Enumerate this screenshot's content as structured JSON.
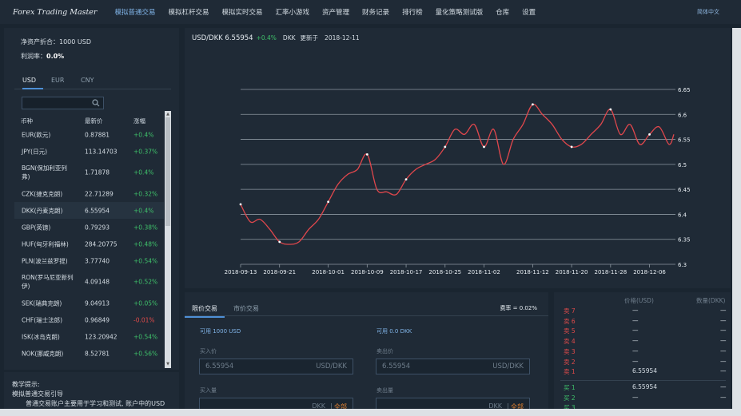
{
  "app": {
    "logo": "Forex Trading Master",
    "lang": "简体中文"
  },
  "nav": [
    "模拟普通交易",
    "模拟杠杆交易",
    "模拟实时交易",
    "汇率小游戏",
    "资产管理",
    "财务记录",
    "排行榜",
    "量化策略测试版",
    "仓库",
    "设置"
  ],
  "account": {
    "net_label": "净资产折合：",
    "net_value": "1000 USD",
    "profit_label": "利润率：",
    "profit_value": "0.0%"
  },
  "currency_tabs": [
    "USD",
    "EUR",
    "CNY"
  ],
  "search": {
    "placeholder": ""
  },
  "table": {
    "headers": [
      "币种",
      "最新价",
      "涨幅"
    ],
    "rows": [
      {
        "name": "EUR(欧元)",
        "price": "0.87881",
        "chg": "+0.4%",
        "dir": "up"
      },
      {
        "name": "JPY(日元)",
        "price": "113.14703",
        "chg": "+0.37%",
        "dir": "up"
      },
      {
        "name": "BGN(保加利亚列弗)",
        "price": "1.71878",
        "chg": "+0.4%",
        "dir": "up"
      },
      {
        "name": "CZK(捷克克朗)",
        "price": "22.71289",
        "chg": "+0.32%",
        "dir": "up"
      },
      {
        "name": "DKK(丹麦克朗)",
        "price": "6.55954",
        "chg": "+0.4%",
        "dir": "up"
      },
      {
        "name": "GBP(英镑)",
        "price": "0.79293",
        "chg": "+0.38%",
        "dir": "up"
      },
      {
        "name": "HUF(匈牙利福林)",
        "price": "284.20775",
        "chg": "+0.48%",
        "dir": "up"
      },
      {
        "name": "PLN(波兰兹罗提)",
        "price": "3.77740",
        "chg": "+0.54%",
        "dir": "up"
      },
      {
        "name": "RON(罗马尼亚新列伊)",
        "price": "4.09148",
        "chg": "+0.52%",
        "dir": "up"
      },
      {
        "name": "SEK(瑞典克朗)",
        "price": "9.04913",
        "chg": "+0.05%",
        "dir": "up"
      },
      {
        "name": "CHF(瑞士法郎)",
        "price": "0.96849",
        "chg": "-0.01%",
        "dir": "down"
      },
      {
        "name": "ISK(冰岛克朗)",
        "price": "123.20942",
        "chg": "+0.54%",
        "dir": "up"
      },
      {
        "name": "NOK(挪威克朗)",
        "price": "8.52781",
        "chg": "+0.56%",
        "dir": "up"
      }
    ]
  },
  "teach": {
    "title": "教学提示:",
    "line1": "模拟普通交易引导",
    "line2": "普通交易账户主要用于学习和测试, 账户中的USD"
  },
  "chart_header": {
    "pair": "USD/DKK 6.55954",
    "change": "+0.4%",
    "unit": "DKK",
    "updated": "更新于",
    "date": "2018-12-11"
  },
  "chart_data": {
    "type": "line",
    "x": [
      "2018-09-13",
      "2018-09-15",
      "2018-09-17",
      "2018-09-19",
      "2018-09-21",
      "2018-09-23",
      "2018-09-25",
      "2018-09-27",
      "2018-09-29",
      "2018-10-01",
      "2018-10-03",
      "2018-10-05",
      "2018-10-07",
      "2018-10-09",
      "2018-10-11",
      "2018-10-13",
      "2018-10-15",
      "2018-10-17",
      "2018-10-19",
      "2018-10-21",
      "2018-10-23",
      "2018-10-25",
      "2018-10-27",
      "2018-10-29",
      "2018-10-31",
      "2018-11-02",
      "2018-11-04",
      "2018-11-06",
      "2018-11-08",
      "2018-11-10",
      "2018-11-12",
      "2018-11-14",
      "2018-11-16",
      "2018-11-18",
      "2018-11-20",
      "2018-11-22",
      "2018-11-24",
      "2018-11-26",
      "2018-11-28",
      "2018-11-30",
      "2018-12-02",
      "2018-12-04",
      "2018-12-06",
      "2018-12-08",
      "2018-12-10",
      "2018-12-11"
    ],
    "values": [
      6.42,
      6.385,
      6.39,
      6.37,
      6.345,
      6.34,
      6.345,
      6.37,
      6.39,
      6.425,
      6.46,
      6.48,
      6.49,
      6.52,
      6.45,
      6.445,
      6.44,
      6.47,
      6.49,
      6.5,
      6.51,
      6.535,
      6.57,
      6.56,
      6.58,
      6.535,
      6.57,
      6.5,
      6.55,
      6.58,
      6.62,
      6.6,
      6.58,
      6.55,
      6.535,
      6.54,
      6.56,
      6.58,
      6.61,
      6.56,
      6.58,
      6.54,
      6.56,
      6.575,
      6.54,
      6.56
    ],
    "xticks": [
      "2018-09-13",
      "2018-09-21",
      "2018-10-01",
      "2018-10-09",
      "2018-10-17",
      "2018-10-25",
      "2018-11-02",
      "2018-11-12",
      "2018-11-20",
      "2018-11-28",
      "2018-12-06"
    ],
    "yticks": [
      "6.3",
      "6.35",
      "6.4",
      "6.45",
      "6.5",
      "6.55",
      "6.6",
      "6.65"
    ],
    "ylim": [
      6.3,
      6.65
    ],
    "grid": true,
    "line_color": "#e0474c"
  },
  "trade": {
    "tabs": [
      "限价交易",
      "市价交易"
    ],
    "fee": "费率 = 0.02%",
    "buy": {
      "avail": "可用 1000 USD",
      "price_label": "买入价",
      "price": "6.55954",
      "price_unit": "USD/DKK",
      "amount_label": "买入量",
      "amount_unit": "DKK",
      "all": "全部",
      "sep": "|"
    },
    "sell": {
      "avail": "可用 0.0 DKK",
      "price_label": "卖出价",
      "price": "6.55954",
      "price_unit": "USD/DKK",
      "amount_label": "卖出量",
      "amount_unit": "DKK",
      "all": "全部",
      "sep": "|"
    }
  },
  "orderbook": {
    "price_header": "价格(USD)",
    "qty_header": "数量(DKK)",
    "asks": [
      {
        "label": "卖 7",
        "price": "—",
        "qty": "—"
      },
      {
        "label": "卖 6",
        "price": "—",
        "qty": "—"
      },
      {
        "label": "卖 5",
        "price": "—",
        "qty": "—"
      },
      {
        "label": "卖 4",
        "price": "—",
        "qty": "—"
      },
      {
        "label": "卖 3",
        "price": "—",
        "qty": "—"
      },
      {
        "label": "卖 2",
        "price": "—",
        "qty": "—"
      },
      {
        "label": "卖 1",
        "price": "6.55954",
        "qty": "—"
      }
    ],
    "bids": [
      {
        "label": "买 1",
        "price": "6.55954",
        "qty": "—"
      },
      {
        "label": "买 2",
        "price": "—",
        "qty": "—"
      },
      {
        "label": "买 3",
        "price": "",
        "qty": ""
      }
    ]
  }
}
